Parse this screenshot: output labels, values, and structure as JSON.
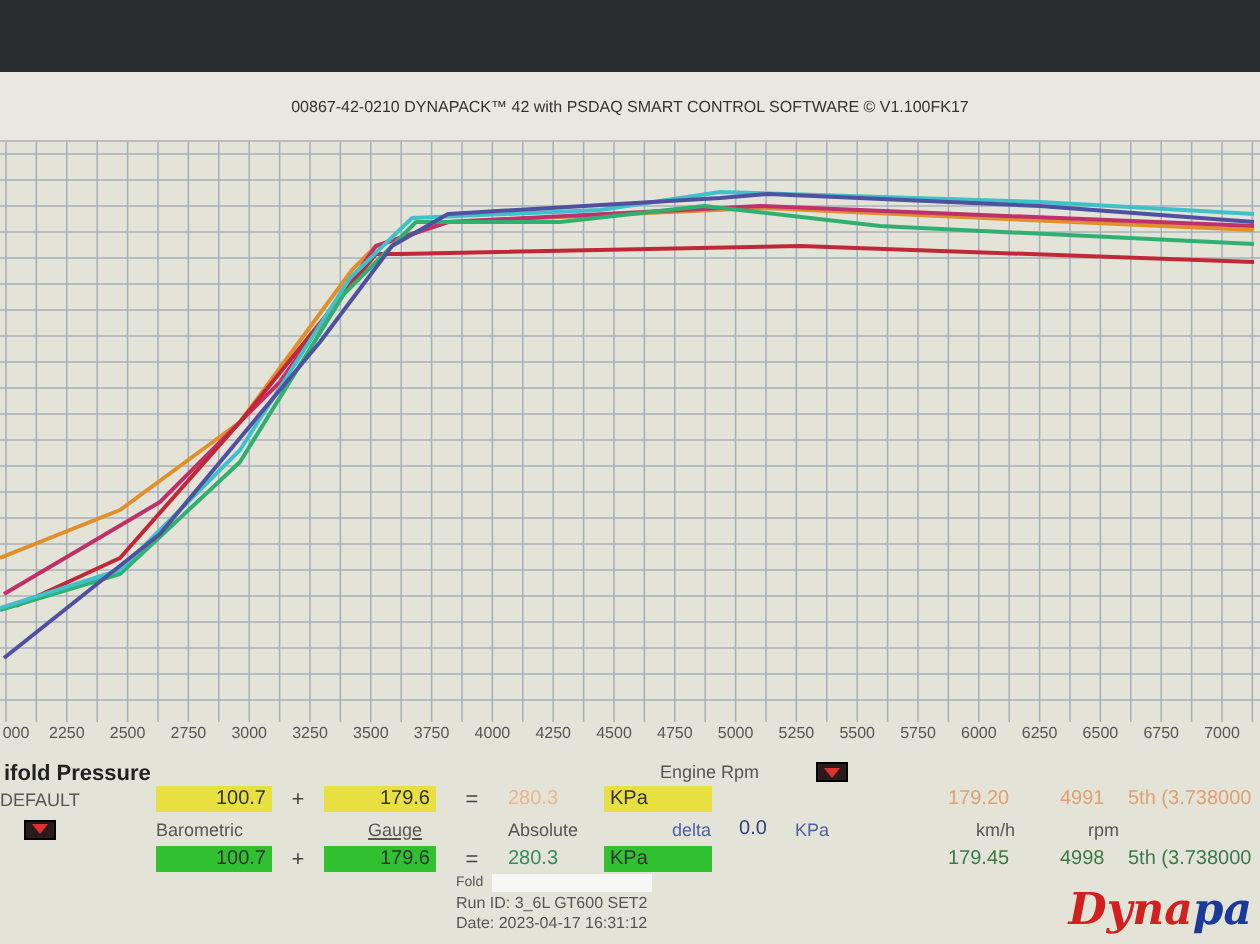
{
  "window": {
    "title": "00867-42-0210 DYNAPACK™ 42 with PSDAQ SMART CONTROL SOFTWARE © V1.100FK17"
  },
  "chart": {
    "x_tick_labels": [
      "000",
      "2250",
      "2500",
      "2750",
      "3000",
      "3250",
      "3500",
      "3750",
      "4000",
      "4250",
      "4500",
      "4750",
      "5000",
      "5250",
      "5500",
      "5750",
      "6000",
      "6250",
      "6500",
      "6750",
      "7000"
    ]
  },
  "panel": {
    "section_title": "ifold Pressure",
    "axis_label": "Engine Rpm",
    "profile": "DEFAULT",
    "rows": [
      {
        "kind": "current",
        "barometric": "100.7",
        "plus": "+",
        "gauge": "179.6",
        "equals": "=",
        "absolute": "280.3",
        "unit": "KPa",
        "speed": "179.20",
        "rpm": "4991",
        "gear": "5th (3.738000"
      },
      {
        "kind": "reference",
        "barometric": "100.7",
        "plus": "+",
        "gauge": "179.6",
        "equals": "=",
        "absolute": "280.3",
        "unit": "KPa",
        "speed": "179.45",
        "rpm": "4998",
        "gear": "5th (3.738000"
      }
    ],
    "labels": {
      "barometric": "Barometric",
      "gauge": "Gauge",
      "absolute": "Absolute",
      "delta": "delta",
      "delta_value": "0.0",
      "delta_unit": "KPa",
      "speed_unit": "km/h",
      "rpm_unit": "rpm"
    },
    "file_label": "Fold",
    "run_id": "Run ID: 3_6L GT600 SET2",
    "date": "Date: 2023-04-17 16:31:12"
  },
  "logo": {
    "first": "Dyna",
    "second": "pa"
  }
}
